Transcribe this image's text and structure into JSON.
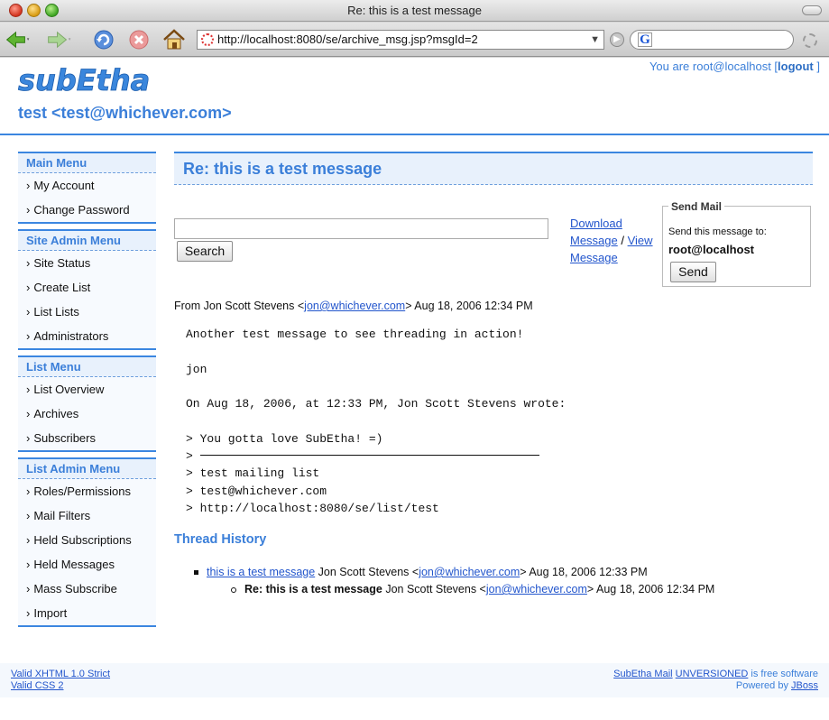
{
  "window": {
    "title": "Re: this is a test message"
  },
  "browser": {
    "url": "http://localhost:8080/se/archive_msg.jsp?msgId=2",
    "search_engine_letter": "G"
  },
  "header": {
    "logo_text": "subEtha",
    "user_prefix": "You are root@localhost [",
    "logout_label": "logout",
    "user_suffix": " ]",
    "list_title": "test <test@whichever.com>"
  },
  "sidebar": {
    "menus": [
      {
        "title": "Main Menu",
        "items": [
          "My Account",
          "Change Password"
        ]
      },
      {
        "title": "Site Admin Menu",
        "items": [
          "Site Status",
          "Create List",
          "List Lists",
          "Administrators"
        ]
      },
      {
        "title": "List Menu",
        "items": [
          "List Overview",
          "Archives",
          "Subscribers"
        ]
      },
      {
        "title": "List Admin Menu",
        "items": [
          "Roles/Permissions",
          "Mail Filters",
          "Held Subscriptions",
          "Held Messages",
          "Mass Subscribe",
          "Import"
        ]
      }
    ]
  },
  "message": {
    "subject": "Re: this is a test message",
    "search_value": "",
    "search_button": "Search",
    "download_link_1": "Download",
    "download_link_2": "Message",
    "separator": " / ",
    "view_link_1": "View",
    "view_link_2": "Message",
    "send_mail_legend": "Send Mail",
    "send_mail_label": "Send this message to:",
    "send_mail_address": "root@localhost",
    "send_button": "Send",
    "from_prefix": "From Jon Scott Stevens <",
    "from_email": "jon@whichever.com",
    "from_suffix": "> Aug 18, 2006 12:34 PM",
    "body_lines": [
      "Another test message to see threading in action!",
      "",
      "jon",
      "",
      "On Aug 18, 2006, at 12:33 PM, Jon Scott Stevens wrote:",
      "",
      "> You gotta love SubEtha! =)",
      "> ",
      "> test mailing list",
      "> test@whichever.com",
      "> http://localhost:8080/se/list/test"
    ]
  },
  "thread": {
    "title": "Thread History",
    "items": [
      {
        "subject": "this is a test message",
        "from": " Jon Scott Stevens <",
        "email": "jon@whichever.com",
        "date": "> Aug 18, 2006 12:33 PM"
      },
      {
        "subject": "Re: this is a test message",
        "from": " Jon Scott Stevens <",
        "email": "jon@whichever.com",
        "date": "> Aug 18, 2006 12:34 PM"
      }
    ]
  },
  "footer": {
    "valid_xhtml": "Valid XHTML 1.0 Strict",
    "valid_css": "Valid CSS 2",
    "product": "SubEtha Mail",
    "version": "UNVERSIONED",
    "free_text": " is free software",
    "powered_prefix": "Powered by ",
    "powered_by": "JBoss"
  }
}
